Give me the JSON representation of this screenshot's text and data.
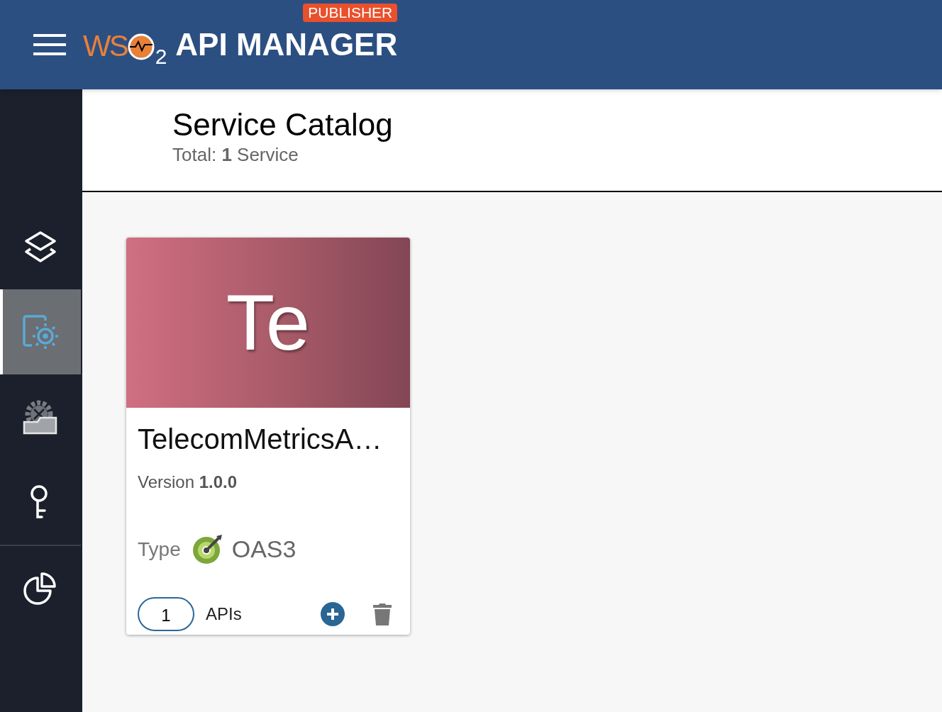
{
  "header": {
    "logo": {
      "left": "WS",
      "sub": "2"
    },
    "product": "API MANAGER",
    "badge": "PUBLISHER"
  },
  "sidebar": {
    "items": [
      {
        "kind": "layers",
        "selected": false
      },
      {
        "kind": "service",
        "selected": true
      },
      {
        "kind": "tools",
        "selected": false
      },
      {
        "kind": "key",
        "selected": false,
        "divider_after": true
      },
      {
        "kind": "chart",
        "selected": false
      }
    ]
  },
  "page": {
    "title": "Service Catalog",
    "total": "Total: **1** Service"
  },
  "cards": [
    {
      "thumb": "Te",
      "name": "TelecomMetricsA…",
      "version": "Version **1.0.0**",
      "type_label": "Type",
      "type": "OAS3",
      "api_count": "1",
      "apis_label": "APIs"
    }
  ]
}
